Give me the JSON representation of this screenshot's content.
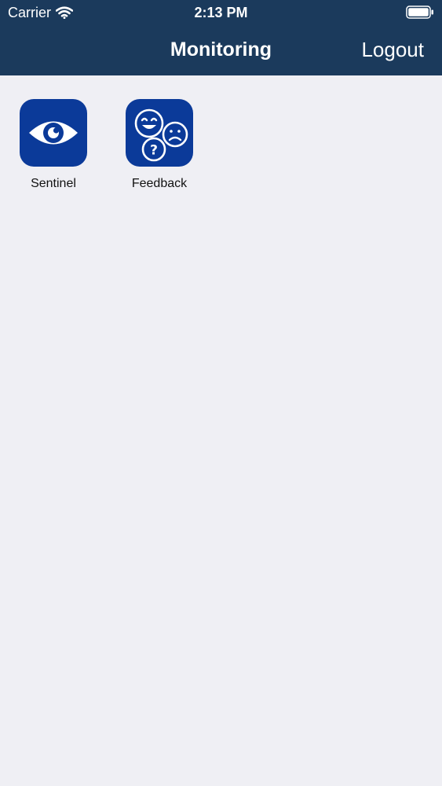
{
  "status_bar": {
    "carrier": "Carrier",
    "time": "2:13 PM",
    "wifi_icon": "wifi-icon",
    "battery_icon": "battery-icon"
  },
  "nav": {
    "title": "Monitoring",
    "logout_label": "Logout"
  },
  "apps": [
    {
      "label": "Sentinel",
      "icon": "eye-icon"
    },
    {
      "label": "Feedback",
      "icon": "faces-feedback-icon"
    }
  ],
  "colors": {
    "nav_background": "#1b3a5c",
    "page_background": "#efeff4",
    "icon_background": "#0b3a99",
    "nav_text": "#ffffff"
  }
}
